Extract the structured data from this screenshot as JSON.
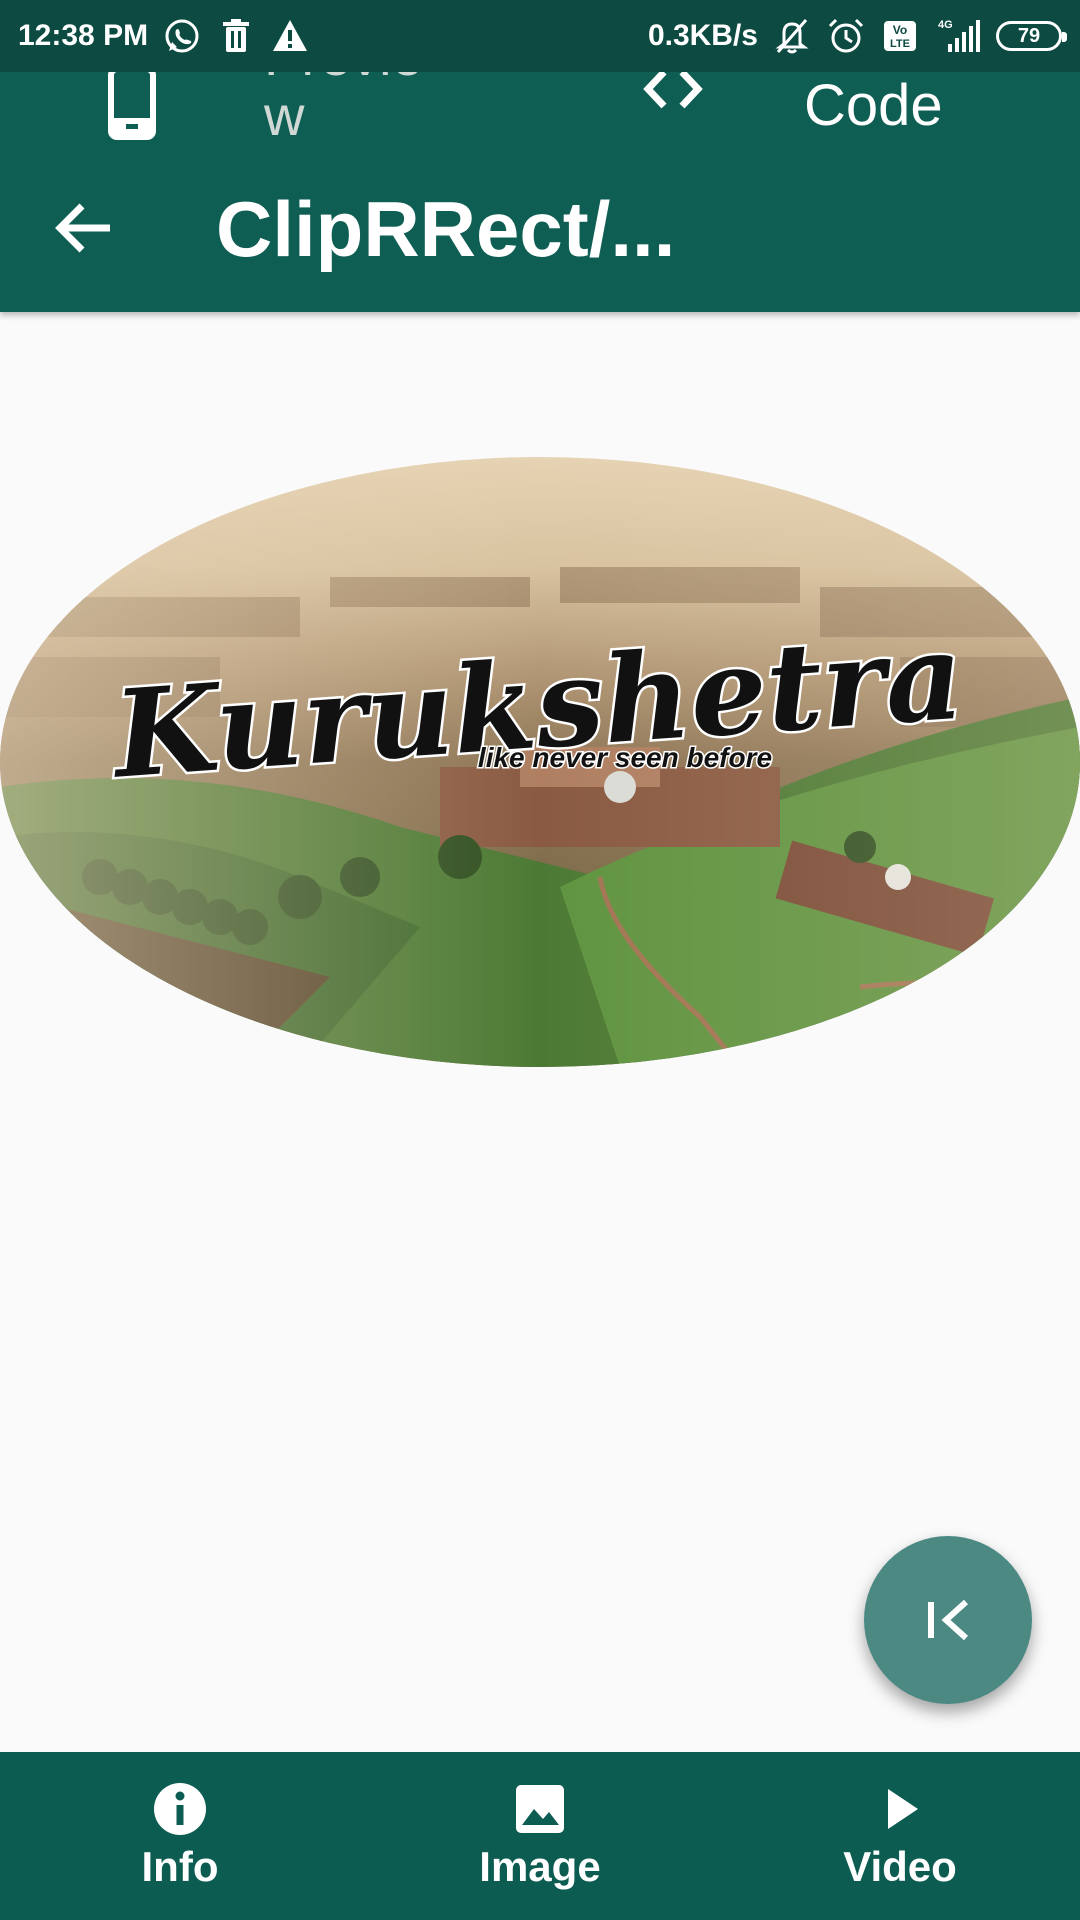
{
  "status_bar": {
    "time": "12:38 PM",
    "network_speed": "0.3KB/s",
    "network_type": "4G",
    "volte": "Vo LTE",
    "battery": "79",
    "icons": [
      "whatsapp-icon",
      "trash-icon",
      "warning-icon",
      "mute-icon",
      "alarm-icon",
      "volte-icon",
      "signal-icon",
      "battery-icon"
    ]
  },
  "tabs": {
    "preview_label": "Preview",
    "code_label": "Code",
    "icons": [
      "phone-icon",
      "code-brackets-icon"
    ]
  },
  "app_bar": {
    "title": "ClipRRect/...",
    "back_icon": "arrow-back-icon"
  },
  "image": {
    "title_text": "Kurukshetra",
    "tagline": "like never seen before"
  },
  "fab": {
    "icon": "skip-previous-icon"
  },
  "bottom_nav": {
    "items": [
      {
        "label": "Info",
        "icon": "info-icon"
      },
      {
        "label": "Image",
        "icon": "image-icon"
      },
      {
        "label": "Video",
        "icon": "play-icon"
      }
    ]
  },
  "colors": {
    "primary": "#0e5e54",
    "status_bar": "#0c4a42",
    "fab": "#4d8983",
    "background": "#fafafa"
  }
}
